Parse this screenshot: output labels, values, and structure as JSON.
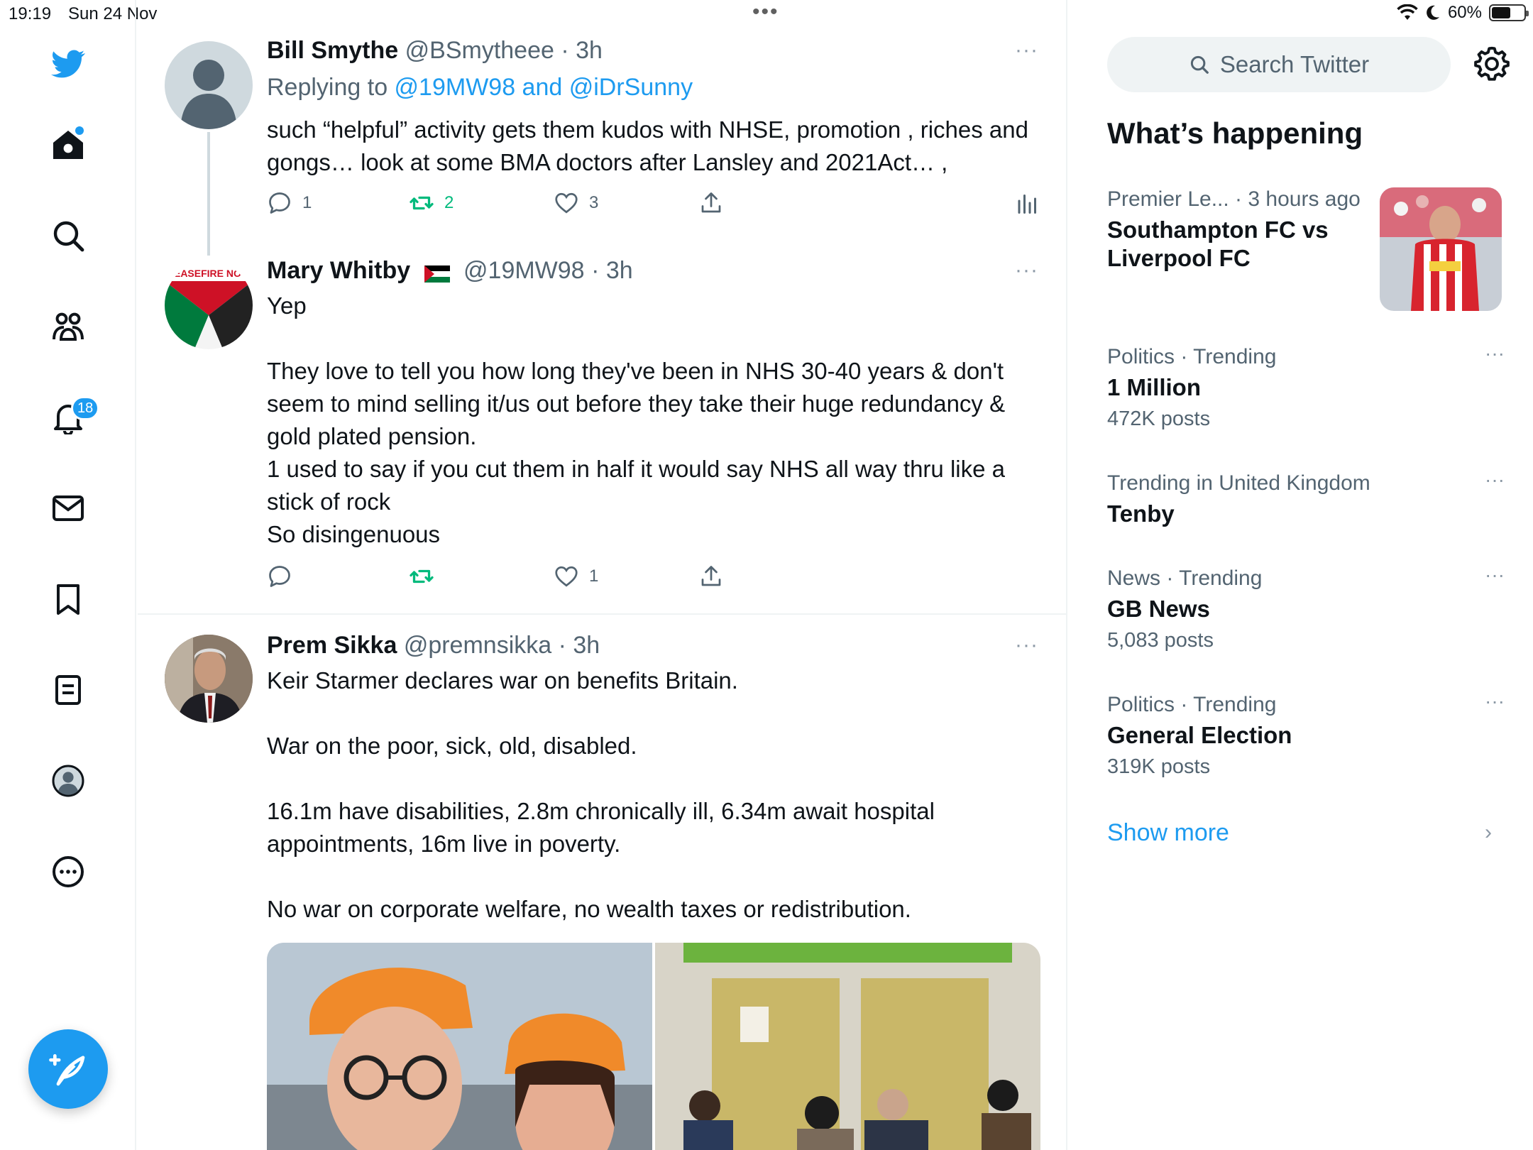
{
  "status_bar": {
    "time": "19:19",
    "date": "Sun 24 Nov",
    "battery": "60%",
    "battery_level": 0.6
  },
  "nav": {
    "notifications_badge": "18",
    "items": [
      "twitter-logo",
      "home-icon",
      "search-icon",
      "communities-icon",
      "notifications-icon",
      "messages-icon",
      "bookmarks-icon",
      "lists-icon",
      "profile-icon",
      "more-icon"
    ]
  },
  "tweets": [
    {
      "name": "Bill Smythe",
      "handle": "@BSmytheee",
      "time": "· 3h",
      "replying_prefix": "Replying to ",
      "replying_to": "@19MW98 and @iDrSunny",
      "text": "such “helpful” activity gets them kudos with NHSE, promotion , riches and gongs… look at some BMA doctors after Lansley and 2021Act… ,",
      "replies": "1",
      "retweets": "2",
      "likes": "3",
      "more": "···"
    },
    {
      "name": "Mary Whitby",
      "flag": "🇵🇸",
      "handle": "@19MW98",
      "time": "· 3h",
      "text": "Yep\n\nThey love to tell you how long they've been in NHS 30-40 years & don't seem to mind selling it/us out before they take their huge redundancy & gold plated pension.\n1 used to say if you cut them in half it would say NHS all way thru like a stick of rock\nSo disingenuous",
      "replies": "",
      "retweets": "",
      "likes": "1",
      "more": "···"
    },
    {
      "name": "Prem Sikka",
      "handle": "@premnsikka",
      "time": "· 3h",
      "text": "Keir Starmer declares war on benefits Britain.\n\nWar on the poor, sick, old, disabled.\n\n16.1m have disabilities, 2.8m chronically ill, 6.34m await hospital appointments, 16m live in poverty.\n\nNo war on corporate welfare, no wealth taxes or redistribution.",
      "more": "···"
    }
  ],
  "sidebar": {
    "search_placeholder": "Search Twitter",
    "section_title": "What’s happening",
    "trends": [
      {
        "context": "Premier Le... · 3 hours ago",
        "name": "Southampton FC vs Liverpool FC",
        "count": ""
      },
      {
        "context": "Politics · Trending",
        "name": "1 Million",
        "count": "472K posts"
      },
      {
        "context": "Trending in United Kingdom",
        "name": "Tenby",
        "count": ""
      },
      {
        "context": "News · Trending",
        "name": "GB News",
        "count": "5,083 posts"
      },
      {
        "context": "Politics · Trending",
        "name": "General Election",
        "count": "319K posts"
      }
    ],
    "show_more": "Show more"
  },
  "colors": {
    "accent": "#1d9bf0",
    "retweet_green": "#00ba7c",
    "secondary_text": "#536471"
  }
}
